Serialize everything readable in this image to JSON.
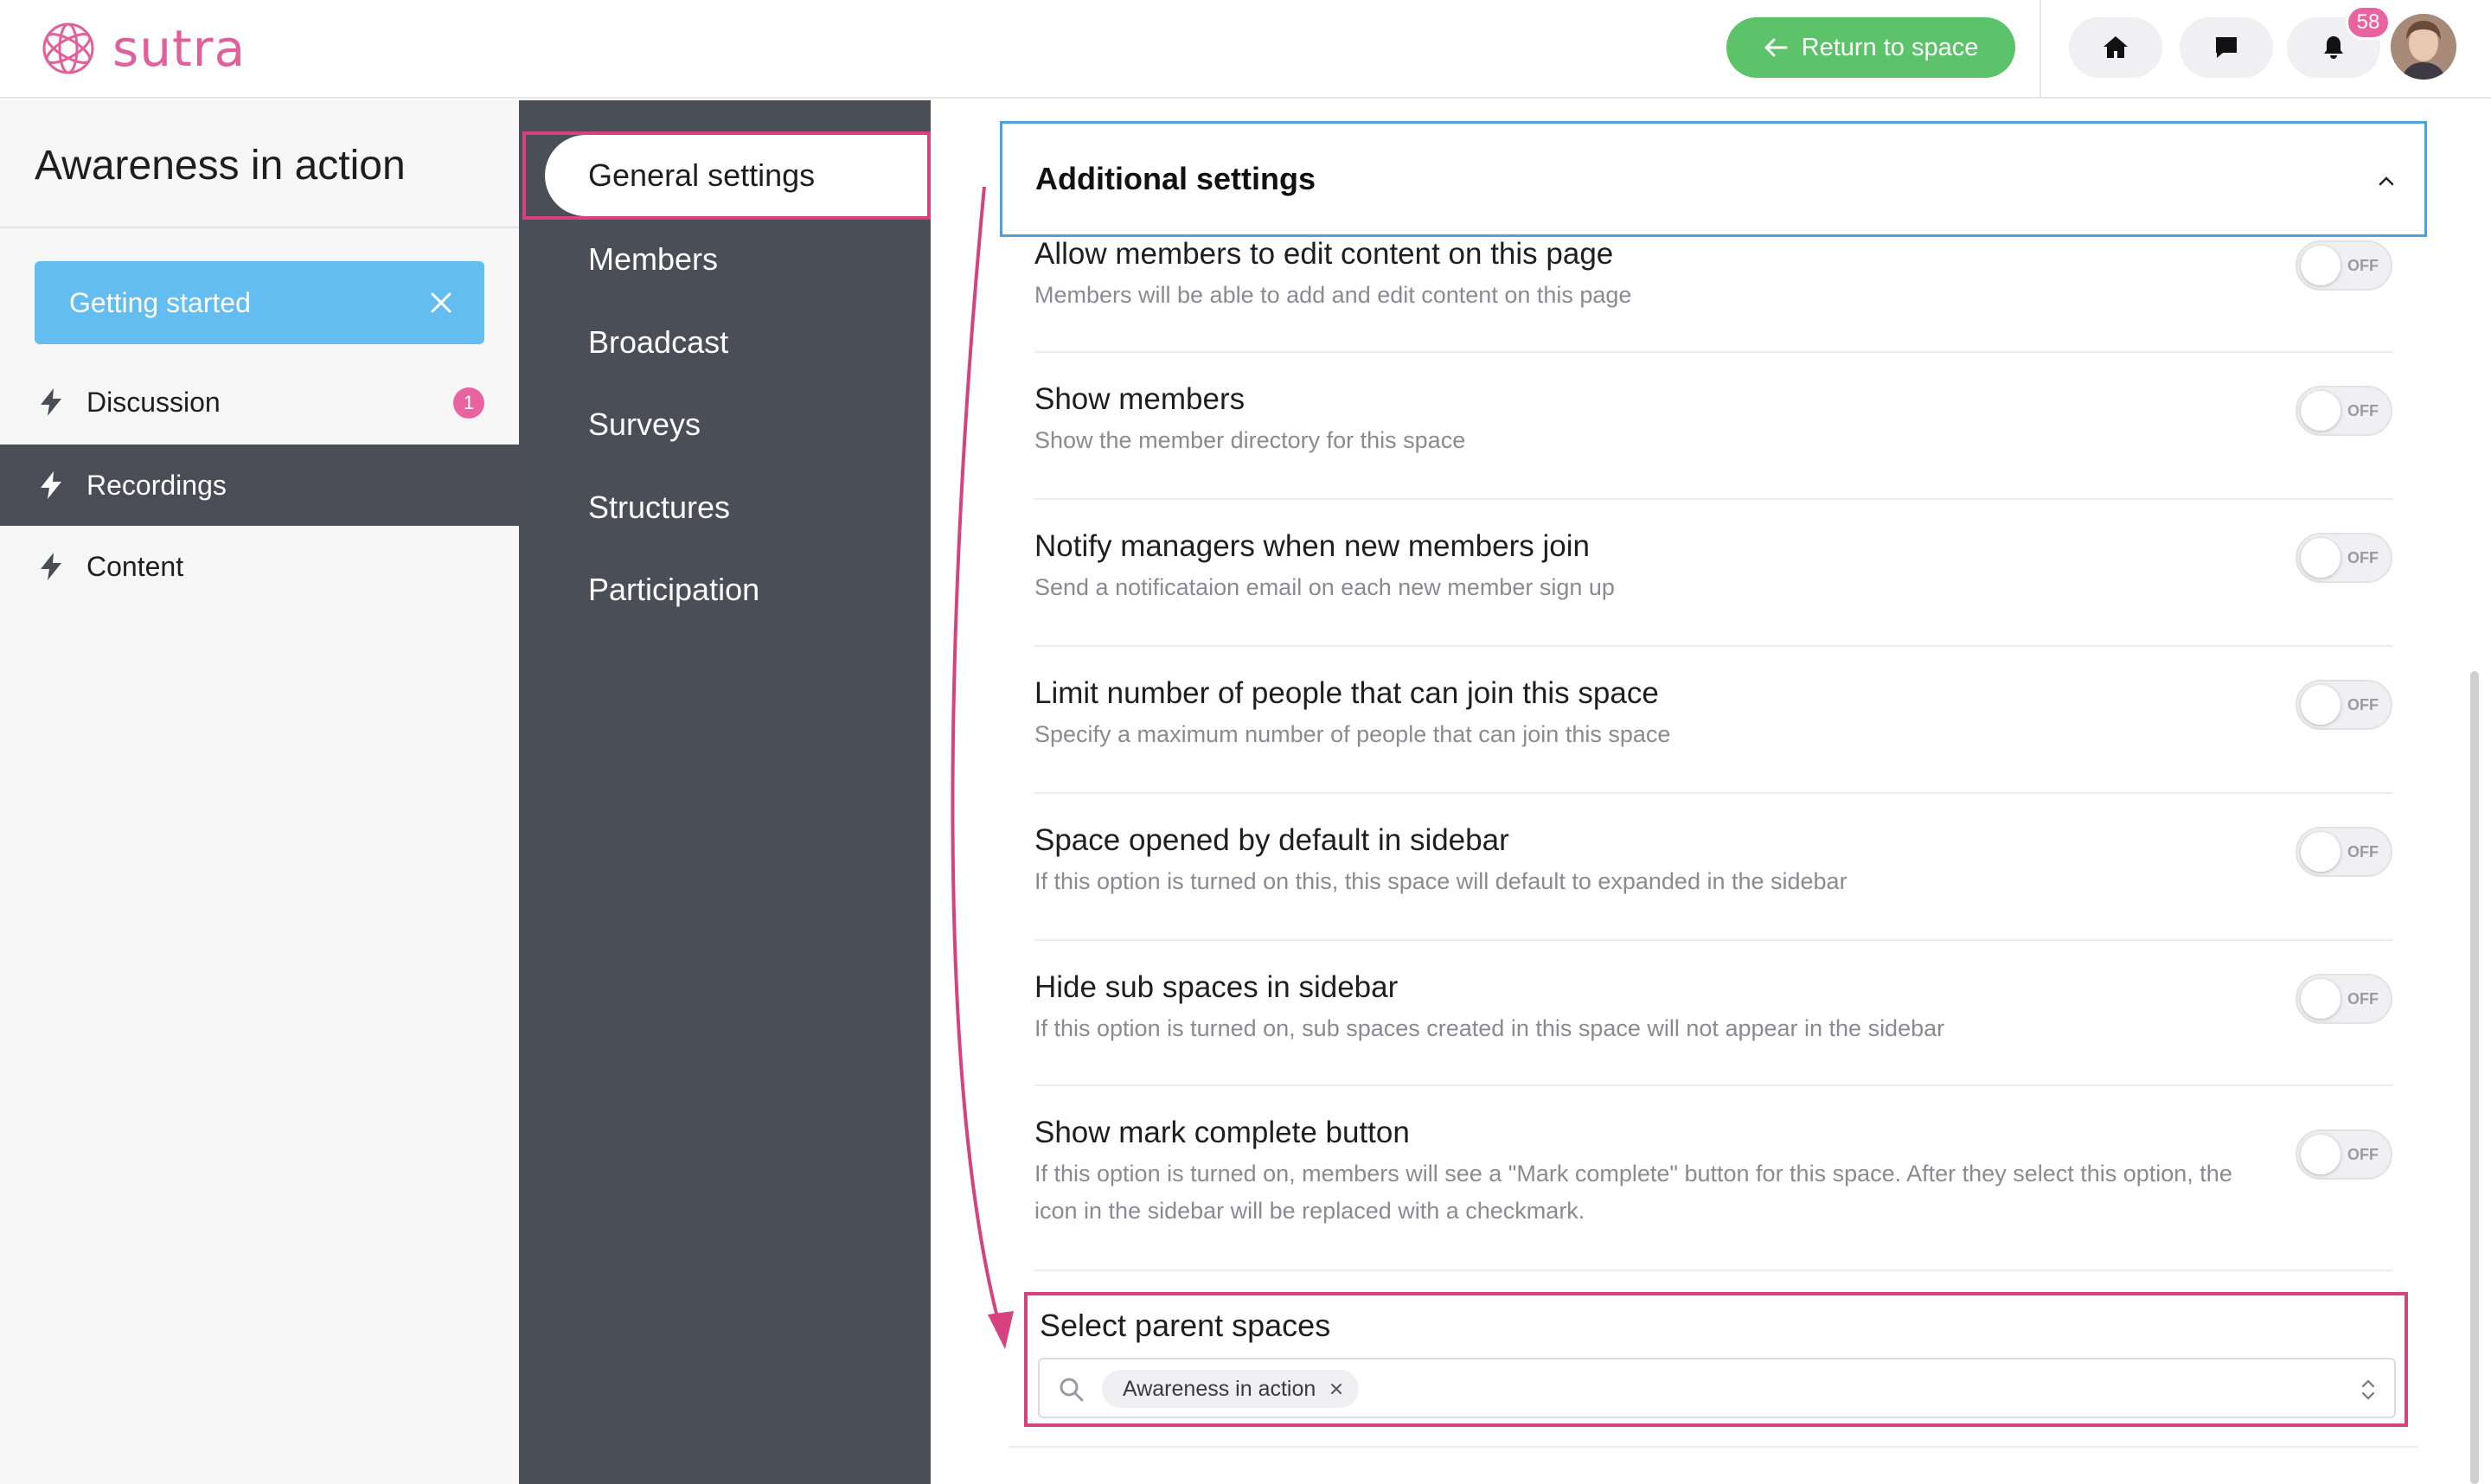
{
  "brand": {
    "name": "sutra",
    "color": "#e0609c"
  },
  "header": {
    "return_label": "Return to space",
    "notification_count": "58",
    "accent_green": "#5cc36b"
  },
  "sidebar": {
    "space_title": "Awareness in action",
    "getting_started_label": "Getting started",
    "items": [
      {
        "label": "Discussion",
        "badge": "1",
        "active": false
      },
      {
        "label": "Recordings",
        "active": true
      },
      {
        "label": "Content",
        "active": false
      }
    ]
  },
  "settings_nav": {
    "items": [
      {
        "label": "General settings",
        "active": true
      },
      {
        "label": "Members"
      },
      {
        "label": "Broadcast"
      },
      {
        "label": "Surveys"
      },
      {
        "label": "Structures"
      },
      {
        "label": "Participation"
      }
    ]
  },
  "main": {
    "section_title": "Additional settings",
    "toggle_off_label": "OFF",
    "settings": [
      {
        "title": "Allow members to edit content on this page",
        "desc": "Members will be able to add and edit content on this page",
        "state": "off"
      },
      {
        "title": "Show members",
        "desc": "Show the member directory for this space",
        "state": "off"
      },
      {
        "title": "Notify managers when new members join",
        "desc": "Send a notificataion email on each new member sign up",
        "state": "off"
      },
      {
        "title": "Limit number of people that can join this space",
        "desc": "Specify a maximum number of people that can join this space",
        "state": "off"
      },
      {
        "title": "Space opened by default in sidebar",
        "desc": "If this option is turned on this, this space will default to expanded in the sidebar",
        "state": "off"
      },
      {
        "title": "Hide sub spaces in sidebar",
        "desc": "If this option is turned on, sub spaces created in this space will not appear in the sidebar",
        "state": "off"
      },
      {
        "title": "Show mark complete button",
        "desc": "If this option is turned on, members will see a \"Mark complete\" button for this space. After they select this option, the icon in the sidebar will be replaced with a checkmark.",
        "state": "off"
      }
    ],
    "parent_spaces": {
      "title": "Select parent spaces",
      "selected": [
        "Awareness in action"
      ]
    }
  },
  "colors": {
    "highlight": "#d6427f",
    "focus_blue": "#4aa3df",
    "nav_dark": "#4a4e57"
  }
}
